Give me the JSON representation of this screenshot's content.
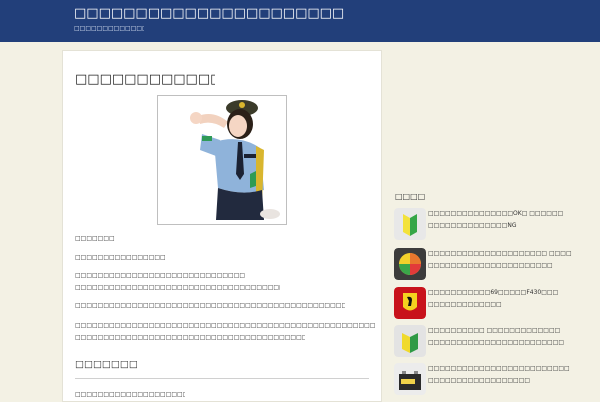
{
  "header": {
    "site_title": "□□□□□□□□□□□□□□□□□□□□□□□□□□□□□□□□□□□□□",
    "site_description": "□□□□□□□□□□□□□□□□□□"
  },
  "post": {
    "title": "□□□□□□□□□□□□□□□□",
    "image_alt": "photo-woman-in-police-uniform",
    "paragraphs": [
      "□□□□□□□",
      "□□□□□□□□□□□□□□□□",
      "□□□□□□□□□□□□□□□□□□□□□□□□□□□□□□□□□□",
      "□□□□□□□□□□□□□□□□□□□□□□□□□□□□□□□□□□□□□□□□□□□□□",
      "□□□□□□□□□□□□□□□□□□□□□□□□□□□□□□□□□□□□□□□□□□□□□□□□□□□□□□□□□□□□□□",
      "□□□□□□□□□□□□□□□□□□□□□□□□□□□□□□□□□□□□□□□□□□□□□□□□□□□□□□□□□□□□□□□□□□□□□□□□□□",
      "□□□□□□□□□□□□□□□□□□□□□□□□□□□□□□□□□□□□□□□□□□□□□□□□□□□□□□□□□□",
      "□□□□□□□□□□□□□□□□□□□□□□□□"
    ],
    "subheading": "□□□□□□□"
  },
  "sidebar": {
    "title": "□□□□",
    "items": [
      {
        "line1": "□□□□□□□□□□□□□□□OK□ □□□□□□",
        "line2": "□□□□□□□□□□□□□□NG",
        "icon": "beginner-mark-icon"
      },
      {
        "line1": "□□□□□□□□□□□□□□□□□□□□□ □□□□",
        "line2": "□□□□□□□□□□□□□□□□□□□□□□",
        "icon": "senior-driver-mark-icon"
      },
      {
        "line1": "□□□□□□□□□□□69□□□□□F430□□□",
        "line2": "□□□□□□□□□□□□□",
        "icon": "ferrari-logo-icon"
      },
      {
        "line1": "□□□□□□□□□□ □□□□□□□□□□□□□",
        "line2": "□□□□□□□□□□□□□□□□□□□□□□□□",
        "icon": "beginner-mark-icon"
      },
      {
        "line1": "□□□□□□□□□□□□□□□□□□□□□□□□□",
        "line2": "□□□□□□□□□□□□□□□□□□",
        "icon": "car-battery-icon"
      }
    ]
  },
  "colors": {
    "header_bg": "#223f7a",
    "page_bg": "#f3f1e4"
  }
}
